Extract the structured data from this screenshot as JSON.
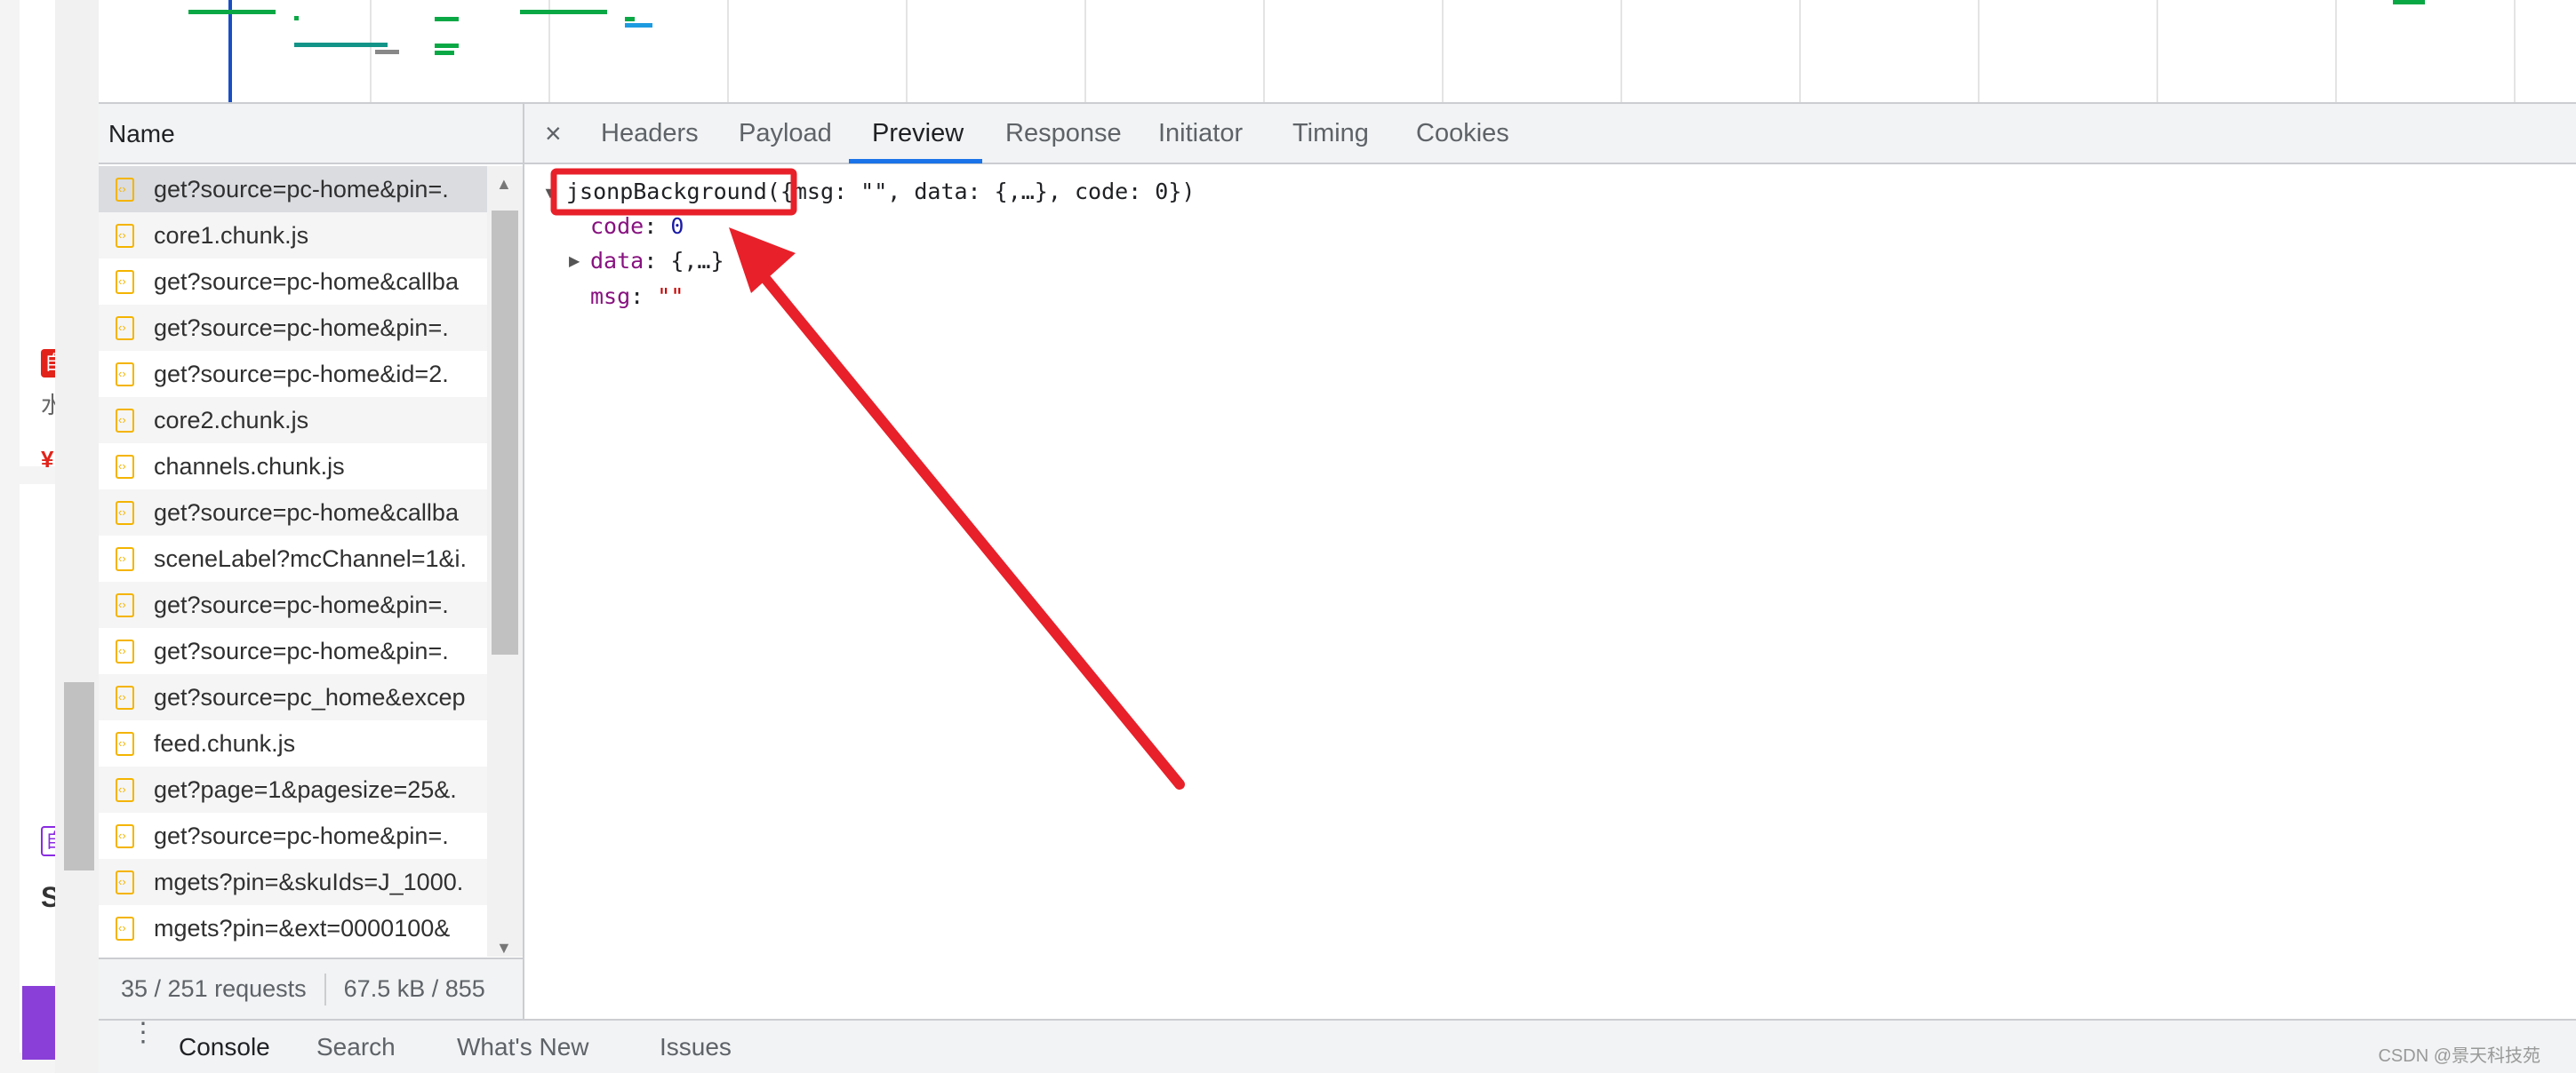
{
  "page_fragments": {
    "badge1": "自",
    "text1": "水",
    "price": "¥",
    "badge2": "自",
    "text2": "S"
  },
  "network": {
    "name_header": "Name",
    "requests": [
      {
        "name": "get?source=pc-home&pin=.",
        "selected": true
      },
      {
        "name": "core1.chunk.js"
      },
      {
        "name": "get?source=pc-home&callba"
      },
      {
        "name": "get?source=pc-home&pin=."
      },
      {
        "name": "get?source=pc-home&id=2."
      },
      {
        "name": "core2.chunk.js"
      },
      {
        "name": "channels.chunk.js"
      },
      {
        "name": "get?source=pc-home&callba"
      },
      {
        "name": "sceneLabel?mcChannel=1&i."
      },
      {
        "name": "get?source=pc-home&pin=."
      },
      {
        "name": "get?source=pc-home&pin=."
      },
      {
        "name": "get?source=pc_home&excep"
      },
      {
        "name": "feed.chunk.js"
      },
      {
        "name": "get?page=1&pagesize=25&."
      },
      {
        "name": "get?source=pc-home&pin=."
      },
      {
        "name": "mgets?pin=&skuIds=J_1000."
      },
      {
        "name": "mgets?pin=&ext=0000100&"
      }
    ],
    "status": {
      "requests": "35 / 251 requests",
      "transferred": "67.5 kB / 855"
    }
  },
  "detail": {
    "close": "×",
    "tabs": [
      {
        "label": "Headers"
      },
      {
        "label": "Payload"
      },
      {
        "label": "Preview",
        "active": true
      },
      {
        "label": "Response"
      },
      {
        "label": "Initiator"
      },
      {
        "label": "Timing"
      },
      {
        "label": "Cookies"
      }
    ],
    "preview": {
      "callback": "jsonpBackground",
      "summary": "({msg: \"\", data: {,…}, code: 0})",
      "code_key": "code",
      "code_val": "0",
      "data_key": "data",
      "data_val": "{,…}",
      "msg_key": "msg",
      "msg_val": "\"\""
    },
    "annotation_color": "#e8202a"
  },
  "drawer": {
    "tabs": [
      "Console",
      "Search",
      "What's New",
      "Issues"
    ]
  },
  "watermark": "CSDN @景天科技苑",
  "colors": {
    "accent": "#1a73e8",
    "file_icon": "#f4b400"
  }
}
